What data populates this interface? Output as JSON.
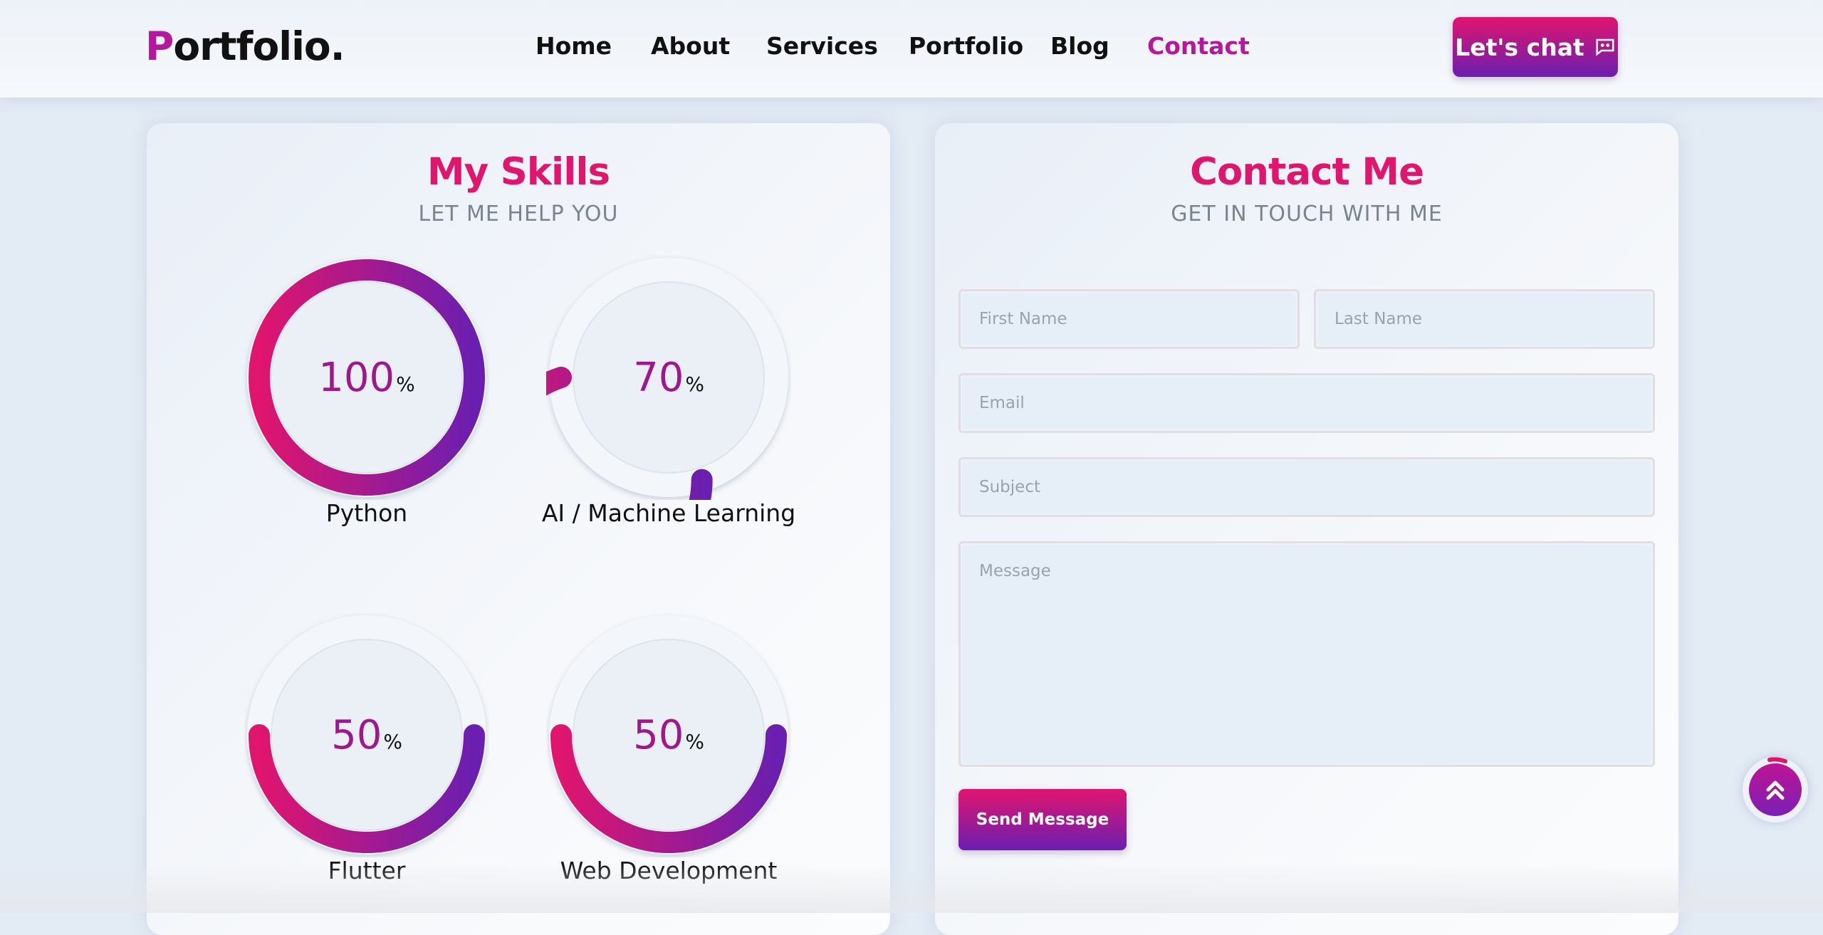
{
  "header": {
    "logo_first": "P",
    "logo_rest": "ortfolio.",
    "nav": [
      {
        "label": "Home",
        "active": false
      },
      {
        "label": "About",
        "active": false
      },
      {
        "label": "Services",
        "active": false
      },
      {
        "label": "Portfolio",
        "active": false
      },
      {
        "label": "Blog",
        "active": false
      },
      {
        "label": "Contact",
        "active": true
      }
    ],
    "chat_button": "Let's chat",
    "chat_icon": "chat-bubble-icon"
  },
  "skills": {
    "title": "My Skills",
    "subtitle": "LET ME HELP YOU",
    "items": [
      {
        "name": "Python",
        "percent": 100,
        "percent_text": "100",
        "unit": "%"
      },
      {
        "name": "AI / Machine Learning",
        "percent": 70,
        "percent_text": "70",
        "unit": "%"
      },
      {
        "name": "Flutter",
        "percent": 50,
        "percent_text": "50",
        "unit": "%"
      },
      {
        "name": "Web Development",
        "percent": 50,
        "percent_text": "50",
        "unit": "%"
      }
    ]
  },
  "contact": {
    "title": "Contact Me",
    "subtitle": "GET IN TOUCH WITH ME",
    "first_name_placeholder": "First Name",
    "last_name_placeholder": "Last Name",
    "email_placeholder": "Email",
    "subject_placeholder": "Subject",
    "message_placeholder": "Message",
    "send_button": "Send Message"
  },
  "back_to_top_icon": "double-chevron-up-icon",
  "colors": {
    "accent_pink": "#e0156e",
    "accent_purple": "#6a1fb0",
    "active_nav": "#b5179e",
    "background": "#e3ebf5"
  }
}
